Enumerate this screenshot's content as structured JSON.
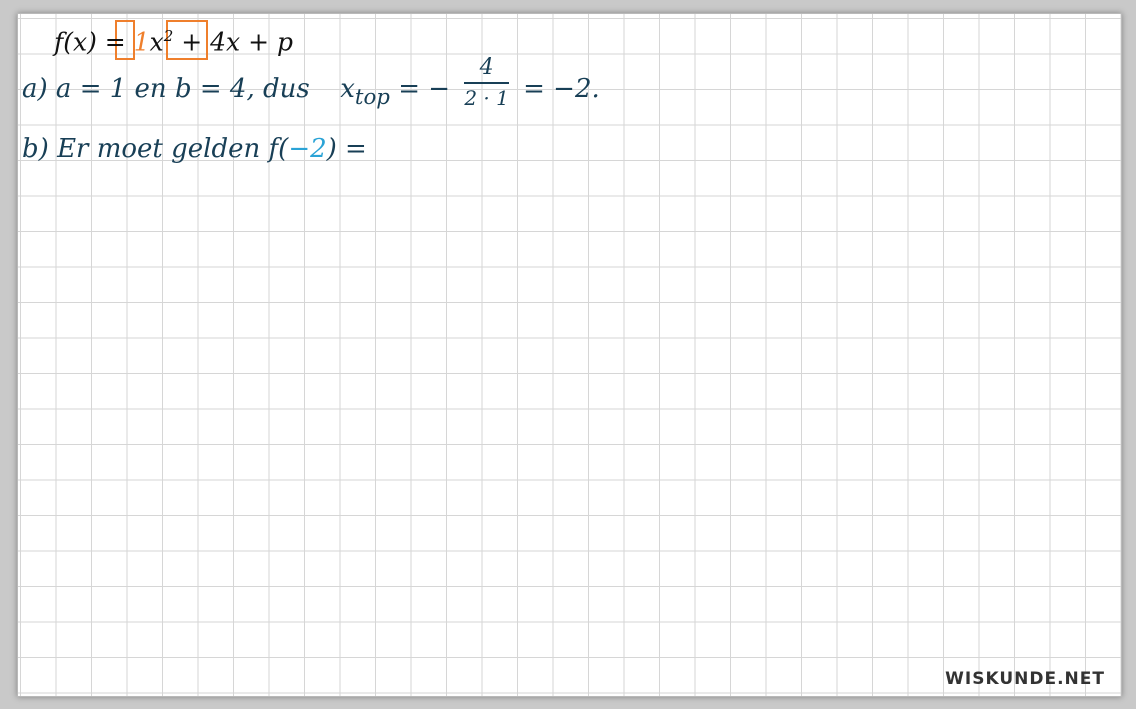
{
  "colors": {
    "ink_black": "#111111",
    "ink_blue": "#183f56",
    "highlight_orange": "#ef7f2c",
    "highlight_cyan": "#2aa3d6",
    "grid": "#d6d6d6"
  },
  "formula": {
    "lhs": "f(x) =",
    "coef_a": "1",
    "x_squared": "x",
    "exp": "2",
    "coef_b": "+ 4",
    "rest": "x + p"
  },
  "part_a": {
    "label": "a)",
    "text": "a = 1 en b = 4, dus",
    "xtop": "x",
    "xtop_sub": "top",
    "eq": "= −",
    "frac_num": "4",
    "frac_den": "2 · 1",
    "result": "= −2."
  },
  "part_b": {
    "label": "b)",
    "text": "Er moet gelden",
    "f_open": "f(",
    "arg": "−2",
    "f_close": ") ="
  },
  "watermark": "WISKUNDE.NET"
}
